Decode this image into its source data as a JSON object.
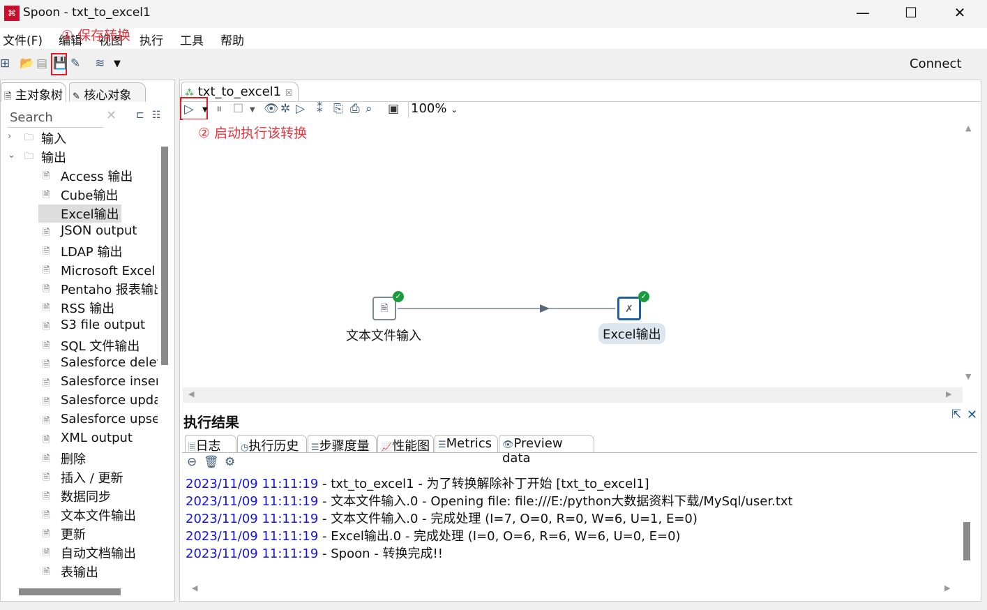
{
  "window": {
    "title": "Spoon - txt_to_excel1",
    "logo": "kettle-logo",
    "min": "—",
    "max": "☐",
    "close": "✕"
  },
  "menu": [
    "文件(F)",
    "编辑",
    "视图",
    "执行",
    "工具",
    "帮助"
  ],
  "annotations": {
    "save": "① 保存转换",
    "run": "② 启动执行该转换"
  },
  "toolbar": {
    "connect": "Connect"
  },
  "left": {
    "tabs": [
      "主对象树",
      "核心对象"
    ],
    "search_placeholder": "Search",
    "tree": [
      {
        "label": "输入",
        "level": 0,
        "expanded": false
      },
      {
        "label": "输出",
        "level": 0,
        "expanded": true
      },
      {
        "label": "Access 输出",
        "level": 1
      },
      {
        "label": "Cube输出",
        "level": 1
      },
      {
        "label": "Excel输出",
        "level": 1,
        "selected": true
      },
      {
        "label": "JSON output",
        "level": 1
      },
      {
        "label": "LDAP 输出",
        "level": 1
      },
      {
        "label": "Microsoft Excel 输出",
        "level": 1
      },
      {
        "label": "Pentaho 报表输出",
        "level": 1
      },
      {
        "label": "RSS 输出",
        "level": 1
      },
      {
        "label": "S3 file output",
        "level": 1
      },
      {
        "label": "SQL 文件输出",
        "level": 1
      },
      {
        "label": "Salesforce delete",
        "level": 1
      },
      {
        "label": "Salesforce insert",
        "level": 1
      },
      {
        "label": "Salesforce update",
        "level": 1
      },
      {
        "label": "Salesforce upsert",
        "level": 1
      },
      {
        "label": "XML output",
        "level": 1
      },
      {
        "label": "删除",
        "level": 1
      },
      {
        "label": "插入 / 更新",
        "level": 1
      },
      {
        "label": "数据同步",
        "level": 1
      },
      {
        "label": "文本文件输出",
        "level": 1
      },
      {
        "label": "更新",
        "level": 1
      },
      {
        "label": "自动文档输出",
        "level": 1
      },
      {
        "label": "表输出",
        "level": 1
      }
    ]
  },
  "editor": {
    "tab": "txt_to_excel1",
    "zoom": "100%",
    "nodes": [
      {
        "label": "文本文件输入",
        "status": "ok"
      },
      {
        "label": "Excel输出",
        "status": "ok"
      }
    ]
  },
  "results": {
    "title": "执行结果",
    "tabs": [
      "日志",
      "执行历史",
      "步骤度量",
      "性能图",
      "Metrics",
      "Preview data"
    ],
    "log": [
      {
        "ts": "2023/11/09 11:11:19",
        "msg": " - txt_to_excel1 - 为了转换解除补丁开始  [txt_to_excel1]"
      },
      {
        "ts": "2023/11/09 11:11:19",
        "msg": " - 文本文件输入.0 - Opening file: file:///E:/python大数据资料下载/MySql/user.txt"
      },
      {
        "ts": "2023/11/09 11:11:19",
        "msg": " - 文本文件输入.0 - 完成处理 (I=7, O=0, R=0, W=6, U=1, E=0)"
      },
      {
        "ts": "2023/11/09 11:11:19",
        "msg": " - Excel输出.0 - 完成处理 (I=0, O=6, R=6, W=6, U=0, E=0)"
      },
      {
        "ts": "2023/11/09 11:11:19",
        "msg": " - Spoon - 转换完成!!"
      }
    ]
  }
}
